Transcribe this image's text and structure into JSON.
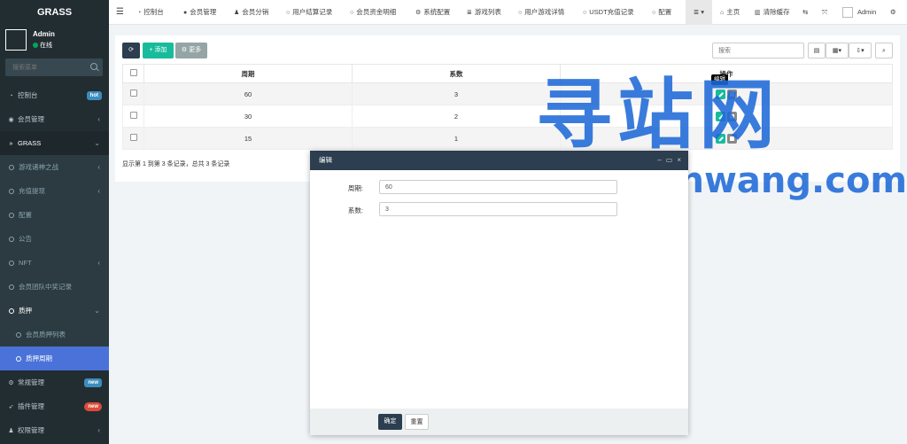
{
  "brand": "GRASS",
  "user": {
    "name": "Admin",
    "status": "在线"
  },
  "sidebar": {
    "search_placeholder": "搜索菜单",
    "items": [
      {
        "label": "控制台",
        "icon": "dashboard-icon",
        "badge": "hot",
        "badge_color": "#3c8dbc"
      },
      {
        "label": "会员管理",
        "icon": "user-circle-icon",
        "chevron": "‹"
      },
      {
        "label": "GRASS",
        "icon": "chevron-right-icon",
        "chevron": "⌄"
      },
      {
        "label": "游戏诸神之战",
        "chevron": "‹"
      },
      {
        "label": "充值提现",
        "chevron": "‹"
      },
      {
        "label": "配置"
      },
      {
        "label": "公告"
      },
      {
        "label": "NFT",
        "chevron": "‹"
      },
      {
        "label": "会员团队中奖记录"
      },
      {
        "label": "质押",
        "chevron": "⌄"
      },
      {
        "label": "会员质押列表"
      },
      {
        "label": "质押周期"
      },
      {
        "label": "常规管理",
        "icon": "cogs-icon",
        "badge": "new",
        "badge_color": "#3c8dbc"
      },
      {
        "label": "插件管理",
        "icon": "rocket-icon",
        "badge": "new",
        "badge_color": "#dd4b39"
      },
      {
        "label": "权限管理",
        "icon": "group-icon",
        "chevron": "‹"
      }
    ]
  },
  "topbar": {
    "tabs": [
      "控制台",
      "会员管理",
      "会员分销",
      "用户结算记录",
      "会员资金明细",
      "系统配置",
      "游戏列表",
      "用户游戏详情",
      "USDT充值记录",
      "配置"
    ],
    "right": {
      "home": "主页",
      "clear": "清除缓存",
      "admin": "Admin"
    }
  },
  "toolbar": {
    "add": "添加",
    "more": "更多",
    "search_placeholder": "搜索"
  },
  "table": {
    "headers": [
      "周期",
      "系数",
      "操作"
    ],
    "rows": [
      {
        "period": "60",
        "factor": "3"
      },
      {
        "period": "30",
        "factor": "2"
      },
      {
        "period": "15",
        "factor": "1"
      }
    ],
    "tooltip": "编辑",
    "pager": "显示第 1 到第 3 条记录，总共 3 条记录"
  },
  "modal": {
    "title": "编辑",
    "fields": [
      {
        "label": "周期:",
        "value": "60"
      },
      {
        "label": "系数:",
        "value": "3"
      }
    ],
    "confirm": "确定",
    "reset": "重置"
  },
  "watermark": {
    "cn": "寻站网",
    "en": "xunzhanwang.com"
  }
}
